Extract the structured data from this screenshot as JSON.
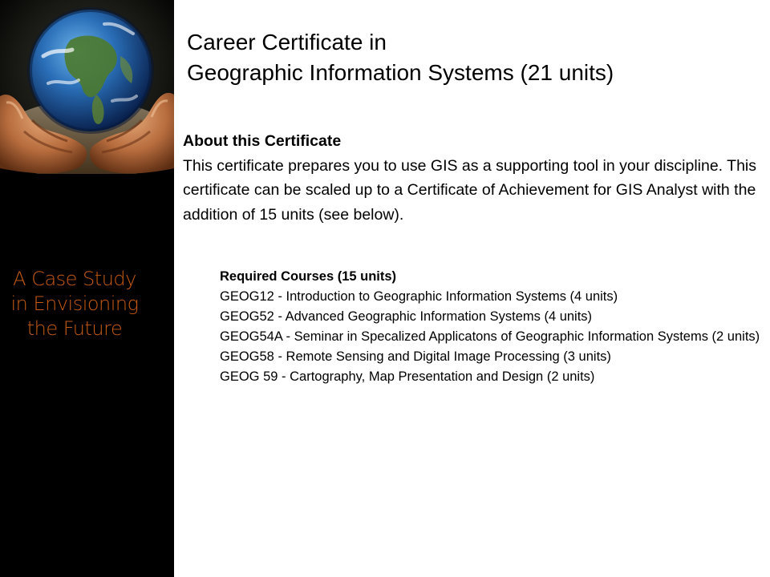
{
  "sidebar": {
    "tagline_lines": [
      "A Case Study",
      "in Envisioning",
      "the Future"
    ],
    "image_icon": "globe-in-hands-icon",
    "tagline_color": "#c45a14",
    "background_color": "#000000"
  },
  "title": {
    "line1": "Career Certificate in",
    "line2": "Geographic Information Systems (21 units)"
  },
  "about": {
    "heading": "About this Certificate",
    "body": "This certificate prepares you to use GIS as a supporting tool in your discipline. This certificate can be scaled up to a Certificate of Achievement for GIS Analyst with the addition of 15 units (see below)."
  },
  "courses": {
    "heading": "Required Courses (15 units)",
    "items": [
      "GEOG12 - Introduction to Geographic Information Systems (4 units)",
      "GEOG52 - Advanced Geographic Information Systems (4 units)",
      "GEOG54A - Seminar in Specalized Applicatons of Geographic Information Systems (2 units)",
      "GEOG58 - Remote Sensing and Digital Image Processing (3 units)",
      "GEOG 59 - Cartography, Map Presentation and Design (2 units)"
    ]
  }
}
